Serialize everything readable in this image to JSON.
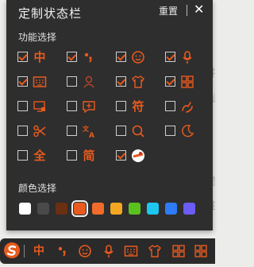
{
  "panel": {
    "title": "定制状态栏",
    "reset_label": "重置",
    "close_label": "✕",
    "function_section_label": "功能选择",
    "color_section_label": "颜色选择"
  },
  "functions": [
    {
      "name": "chinese-mode",
      "icon": "中",
      "checked": true
    },
    {
      "name": "punctuation",
      "icon": "punctuation-icon",
      "checked": true
    },
    {
      "name": "emoji",
      "icon": "smiley-icon",
      "checked": true
    },
    {
      "name": "voice",
      "icon": "microphone-icon",
      "checked": true
    },
    {
      "name": "keyboard",
      "icon": "keyboard-icon",
      "checked": true
    },
    {
      "name": "account",
      "icon": "user-icon",
      "checked": false
    },
    {
      "name": "skin",
      "icon": "shirt-icon",
      "checked": true
    },
    {
      "name": "toolbox",
      "icon": "grid-icon",
      "checked": true
    },
    {
      "name": "screen-capture",
      "icon": "screen-icon",
      "checked": false
    },
    {
      "name": "quick-phrase",
      "icon": "message-icon",
      "checked": false
    },
    {
      "name": "symbols",
      "icon": "符",
      "checked": false
    },
    {
      "name": "handwriting",
      "icon": "hand-icon",
      "checked": false
    },
    {
      "name": "clipboard",
      "icon": "scissors-icon",
      "checked": false
    },
    {
      "name": "translate",
      "icon": "translate-icon",
      "checked": false
    },
    {
      "name": "search",
      "icon": "search-icon",
      "checked": false
    },
    {
      "name": "night-mode",
      "icon": "moon-icon",
      "checked": false
    },
    {
      "name": "full-width",
      "icon": "全",
      "checked": false
    },
    {
      "name": "simplified",
      "icon": "简",
      "checked": false
    },
    {
      "name": "sogou-logo",
      "icon": "sogou-logo-icon",
      "checked": true
    }
  ],
  "colors": [
    "#ffffff",
    "#4a4a4a",
    "#6b2f12",
    "#e85a1e",
    "#f26b2a",
    "#f5a623",
    "#5ac21c",
    "#1ec6f2",
    "#2f7bf5",
    "#6b5cf5"
  ],
  "selected_color": "#e85a1e",
  "status_bar": {
    "items": [
      "中",
      "punctuation-icon",
      "smiley-icon",
      "microphone-icon",
      "keyboard-icon",
      "shirt-icon",
      "grid-icon",
      "grid-icon"
    ]
  }
}
